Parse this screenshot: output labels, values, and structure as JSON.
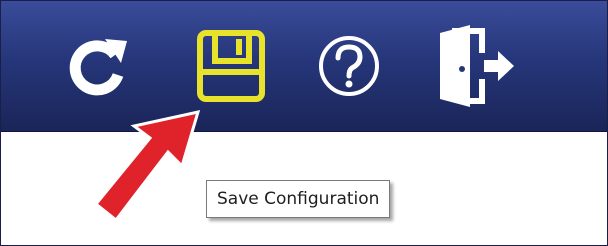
{
  "toolbar": {
    "buttons": [
      {
        "name": "refresh",
        "icon": "refresh-icon"
      },
      {
        "name": "save",
        "icon": "floppy-disk-icon",
        "color": "#e8e22b"
      },
      {
        "name": "help",
        "icon": "question-circle-icon"
      },
      {
        "name": "exit",
        "icon": "exit-door-icon"
      }
    ],
    "background": "#26367a"
  },
  "tooltip": {
    "text": "Save Configuration"
  },
  "annotation": {
    "icon": "red-arrow-icon",
    "color": "#e0232b"
  }
}
